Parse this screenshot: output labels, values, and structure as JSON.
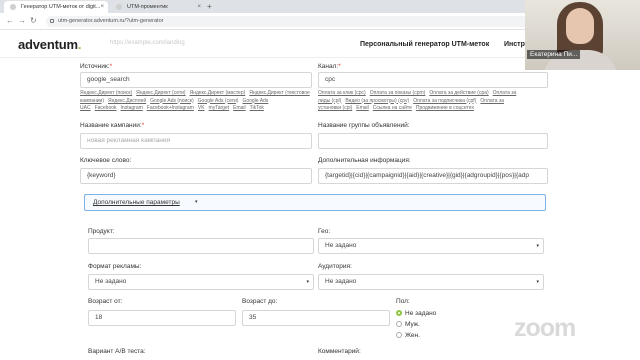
{
  "browser": {
    "tabs": [
      {
        "label": "Генератор UTM-меток от digit...",
        "close": "×"
      },
      {
        "label": "UTM-проментик",
        "close": "×"
      }
    ],
    "new_tab": "+",
    "back": "←",
    "forward": "→",
    "reload": "↻",
    "url": "utm-generator.adventum.ru/?utm-generator"
  },
  "header": {
    "logo_text": "adventum",
    "logo_dot": ".",
    "url_placeholder": "https://example.com/landing",
    "nav": [
      "Персональный генератор UTM-меток",
      "Инстру"
    ]
  },
  "form": {
    "source_label": "Источник:",
    "source_value": "google_search",
    "source_chips": [
      "Яндекс.Директ (поиск)",
      "Яндекс.Директ (сети)",
      "Яндекс.Директ (мастер)",
      "Яндекс.Директ (текстовое",
      "кампании)",
      "Яндекс.Дисплей",
      "Google Ads (поиск)",
      "Google Ads (сети)",
      "Google Ads",
      "UAC",
      "Facebook",
      "Instagram",
      "Facebook+Instagram",
      "VK",
      "myTarget",
      "Email",
      "TikTok"
    ],
    "channel_label": "Канал:",
    "channel_value": "cpc",
    "channel_chips": [
      "Оплата за клик (cpc)",
      "Оплата за показы (cpm)",
      "Оплата за действие (cpa)",
      "Оплата за",
      "лиды (cpl)",
      "Видео (за просмотры) (cpv)",
      "Оплата за подписчика (cpf)",
      "Оплата за",
      "установки (cpi)",
      "Email",
      "Ссылка на сайте",
      "Продвижение в соцсетях"
    ],
    "campaign_label": "Название кампании:",
    "campaign_placeholder": "новая рекламная кампания",
    "adgroup_label": "Название группы объявлений:",
    "keyword_label": "Ключевое слово:",
    "keyword_value": "{keyword}",
    "extra_label": "Дополнительная информация:",
    "extra_value": "{targetid}|{cid}|{campaignid}|{aid}|{creative}|{gid}|{adgroupid}|{pos}|{adp",
    "additional_params": "Дополнительные параметры",
    "additional_caret": "▾",
    "product_label": "Продукт:",
    "geo_label": "Гео:",
    "geo_value": "Не задано",
    "format_label": "Формат рекламы:",
    "format_value": "Не задано",
    "audience_label": "Аудитория:",
    "audience_value": "Не задано",
    "age_from_label": "Возраст от:",
    "age_from_value": "18",
    "age_to_label": "Возраст до:",
    "age_to_value": "35",
    "gender_label": "Пол:",
    "gender_options": [
      "Не задано",
      "Муж.",
      "Жен."
    ],
    "gender_selected": 0,
    "ab_label": "Вариант А/В теста:",
    "comment_label": "Комментарий:",
    "select_arrow": "▾"
  },
  "video": {
    "participant_name": "Екатерина Пи...",
    "watermark": "zoom"
  }
}
